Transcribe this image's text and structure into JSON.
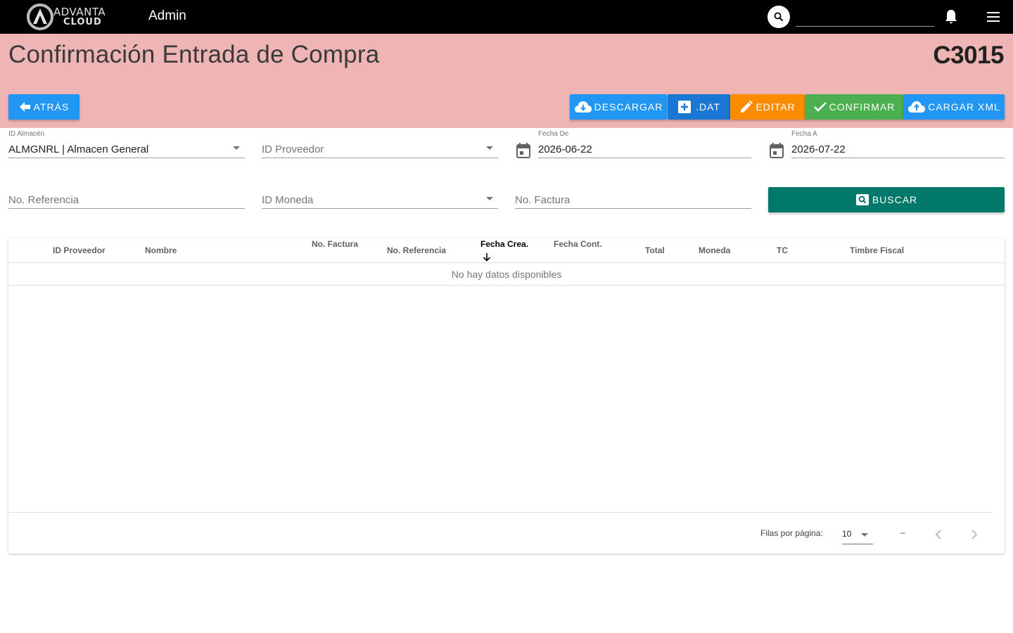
{
  "topbar": {
    "logo_line1": "ADVANTA",
    "logo_line2": "CLOUD",
    "title": "Admin",
    "search_value": "",
    "icons": [
      "search-icon",
      "bell-icon",
      "menu-icon"
    ]
  },
  "header": {
    "title": "Confirmación Entrada de Compra",
    "code": "C3015",
    "background_color": "#efb4b4"
  },
  "actions": {
    "back": "ATRÁS",
    "download": "DESCARGAR",
    "dat": ".DAT",
    "edit": "EDITAR",
    "confirm": "CONFIRMAR",
    "upload_xml": "CARGAR XML",
    "search": "BUSCAR"
  },
  "filters": {
    "almacen": {
      "label": "ID Almacén",
      "value": "ALMGNRL | Almacen General"
    },
    "proveedor": {
      "placeholder": "ID Proveedor"
    },
    "fecha_de": {
      "label": "Fecha De",
      "value": "2026-06-22"
    },
    "fecha_a": {
      "label": "Fecha A",
      "value": "2026-07-22"
    },
    "referencia": {
      "placeholder": "No. Referencia"
    },
    "moneda": {
      "placeholder": "ID Moneda"
    },
    "factura": {
      "placeholder": "No. Factura"
    }
  },
  "table": {
    "columns": [
      "ID Proveedor",
      "Nombre",
      "No. Factura",
      "No. Referencia",
      "Fecha Crea.",
      "Fecha Cont.",
      "Total",
      "Moneda",
      "TC",
      "Timbre Fiscal"
    ],
    "sorted_column": "Fecha Crea.",
    "sort_direction": "desc",
    "empty_text": "No hay datos disponibles",
    "rows": []
  },
  "pagination": {
    "rows_per_page_label": "Filas por página:",
    "rows_per_page": "10",
    "range": "–"
  },
  "colors": {
    "primary": "#2196f3",
    "dat": "#1976d2",
    "edit": "#fb8c00",
    "confirm": "#4caf50",
    "search": "#00796b"
  }
}
